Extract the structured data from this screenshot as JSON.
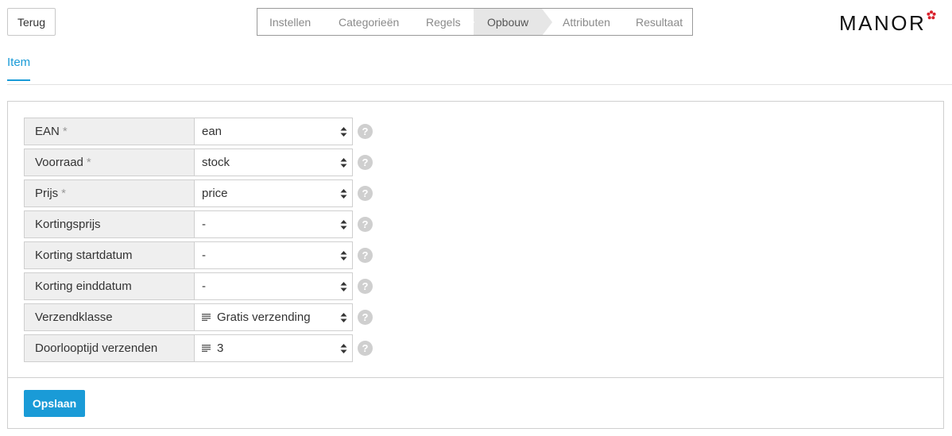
{
  "header": {
    "back_label": "Terug",
    "steps": [
      {
        "label": "Instellen"
      },
      {
        "label": "Categorieën"
      },
      {
        "label": "Regels"
      },
      {
        "label": "Opbouw",
        "active": true
      },
      {
        "label": "Attributen"
      },
      {
        "label": "Resultaat"
      }
    ],
    "logo_text": "MANOR",
    "logo_color": "#d9212c"
  },
  "tabs": [
    {
      "label": "Item",
      "active": true
    }
  ],
  "form": {
    "fields": [
      {
        "label": "EAN",
        "required_marker": "*",
        "value": "ean"
      },
      {
        "label": "Voorraad",
        "required_marker": "*",
        "value": "stock"
      },
      {
        "label": "Prijs",
        "required_marker": "*",
        "value": "price"
      },
      {
        "label": "Kortingsprijs",
        "value": "-"
      },
      {
        "label": "Korting startdatum",
        "value": "-"
      },
      {
        "label": "Korting einddatum",
        "value": "-"
      },
      {
        "label": "Verzendklasse",
        "value": "Gratis verzending",
        "icon": "text-lines-icon"
      },
      {
        "label": "Doorlooptijd verzenden",
        "value": "3",
        "icon": "text-lines-icon"
      }
    ],
    "help_glyph": "?",
    "save_label": "Opslaan"
  },
  "colors": {
    "accent": "#1a9bd7",
    "active_step": "#e6e6e6"
  }
}
